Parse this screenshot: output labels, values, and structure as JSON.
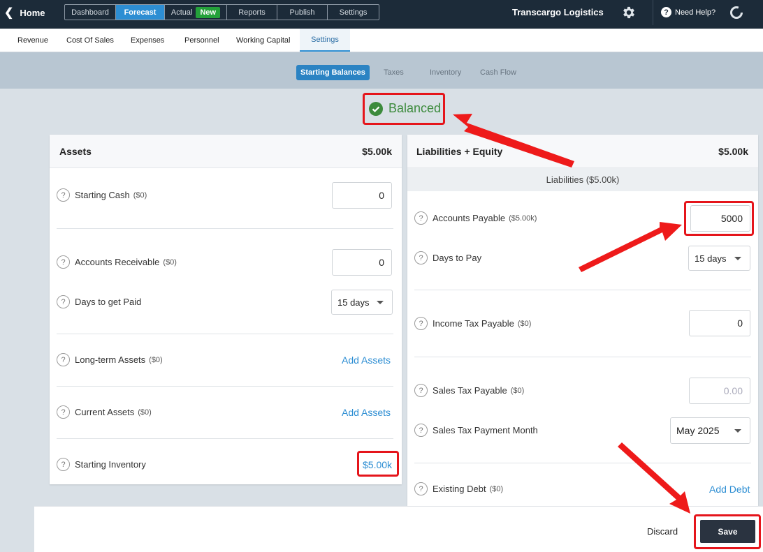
{
  "topnav": {
    "home_label": "Home",
    "tabs": [
      "Dashboard",
      "Forecast",
      "Actual",
      "Reports",
      "Publish",
      "Settings"
    ],
    "new_badge": "New",
    "company": "Transcargo Logistics",
    "help_label": "Need Help?",
    "help_icon_text": "?"
  },
  "subnav": {
    "tabs": [
      "Revenue",
      "Cost Of Sales",
      "Expenses",
      "Personnel",
      "Working Capital",
      "Settings"
    ]
  },
  "settings_tabs": [
    "Starting Balances",
    "Taxes",
    "Inventory",
    "Cash Flow"
  ],
  "status": {
    "balanced_label": "Balanced"
  },
  "assets": {
    "title": "Assets",
    "total": "$5.00k",
    "starting_cash": {
      "label": "Starting Cash",
      "sub": "($0)",
      "value": "0"
    },
    "accounts_receivable": {
      "label": "Accounts Receivable",
      "sub": "($0)",
      "value": "0"
    },
    "days_to_get_paid": {
      "label": "Days to get Paid",
      "value": "15 days"
    },
    "long_term_assets": {
      "label": "Long-term Assets",
      "sub": "($0)",
      "link": "Add Assets"
    },
    "current_assets": {
      "label": "Current Assets",
      "sub": "($0)",
      "link": "Add Assets"
    },
    "starting_inventory": {
      "label": "Starting Inventory",
      "link": "$5.00k"
    }
  },
  "liabilities": {
    "title": "Liabilities + Equity",
    "total": "$5.00k",
    "section_label": "Liabilities  ($5.00k)",
    "accounts_payable": {
      "label": "Accounts Payable",
      "sub": "($5.00k)",
      "value": "5000"
    },
    "days_to_pay": {
      "label": "Days to Pay",
      "value": "15 days"
    },
    "income_tax_payable": {
      "label": "Income Tax Payable",
      "sub": "($0)",
      "value": "0"
    },
    "sales_tax_payable": {
      "label": "Sales Tax Payable",
      "sub": "($0)",
      "value": "0.00"
    },
    "sales_tax_payment_month": {
      "label": "Sales Tax Payment Month",
      "value": "May 2025"
    },
    "existing_debt": {
      "label": "Existing Debt",
      "sub": "($0)",
      "link": "Add Debt"
    }
  },
  "footer": {
    "discard_label": "Discard",
    "save_label": "Save"
  },
  "help_icon_text": "?",
  "colors": {
    "accent": "#2d8ed3",
    "nav_bg": "#1c2b39",
    "balanced_green": "#3d8b3d",
    "annotation_red": "#e5151b"
  }
}
